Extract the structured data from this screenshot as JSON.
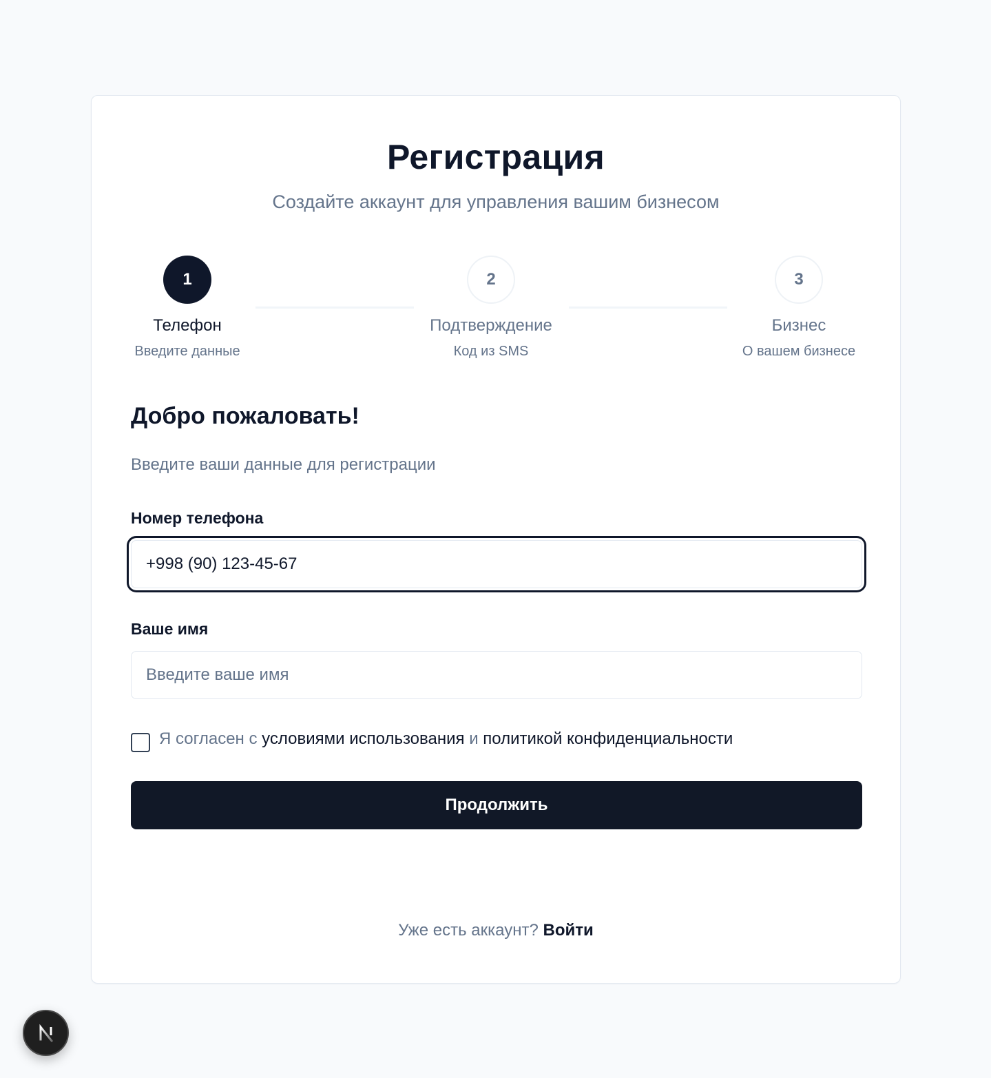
{
  "header": {
    "title": "Регистрация",
    "subtitle": "Создайте аккаунт для управления вашим бизнесом"
  },
  "steps": [
    {
      "number": "1",
      "title": "Телефон",
      "subtitle": "Введите данные",
      "state": "active"
    },
    {
      "number": "2",
      "title": "Подтверждение",
      "subtitle": "Код из SMS",
      "state": "inactive"
    },
    {
      "number": "3",
      "title": "Бизнес",
      "subtitle": "О вашем бизнесе",
      "state": "inactive"
    }
  ],
  "form": {
    "heading": "Добро пожаловать!",
    "description": "Введите ваши данные для регистрации",
    "phone": {
      "label": "Номер телефона",
      "value": "+998 (90) 123-45-67"
    },
    "name": {
      "label": "Ваше имя",
      "value": "",
      "placeholder": "Введите ваше имя"
    },
    "terms": {
      "prefix": "Я согласен с",
      "terms_link": "условиями использования",
      "conjunction": "и",
      "privacy_link": "политикой конфиденциальности",
      "checked": false
    },
    "submit_label": "Продолжить"
  },
  "footer": {
    "prompt": "Уже есть аккаунт?",
    "login_link": "Войти"
  },
  "dev_badge": {
    "icon": "nextjs-logo-icon"
  },
  "colors": {
    "primary": "#0f172a",
    "muted": "#64748b",
    "border": "#e2e8f0",
    "background": "#f8fafc"
  }
}
